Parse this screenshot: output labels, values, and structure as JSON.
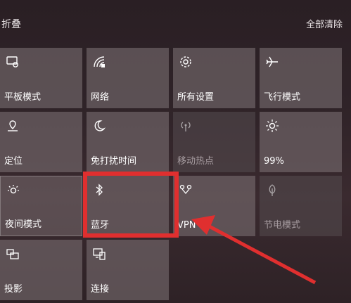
{
  "header": {
    "collapse_label": "折叠",
    "clear_all_label": "全部清除"
  },
  "tiles": [
    {
      "label": "平板模式",
      "icon": "tablet-mode-icon"
    },
    {
      "label": "网络",
      "icon": "network-icon"
    },
    {
      "label": "所有设置",
      "icon": "gear-icon"
    },
    {
      "label": "飞行模式",
      "icon": "airplane-icon"
    },
    {
      "label": "定位",
      "icon": "location-icon"
    },
    {
      "label": "免打扰时间",
      "icon": "moon-icon"
    },
    {
      "label": "移动热点",
      "icon": "hotspot-icon",
      "disabled": true
    },
    {
      "label": "99%",
      "icon": "brightness-icon"
    },
    {
      "label": "夜间模式",
      "icon": "night-light-icon"
    },
    {
      "label": "蓝牙",
      "icon": "bluetooth-icon"
    },
    {
      "label": "VPN",
      "icon": "vpn-icon"
    },
    {
      "label": "节电模式",
      "icon": "battery-saver-icon",
      "disabled": true
    },
    {
      "label": "投影",
      "icon": "project-icon"
    },
    {
      "label": "连接",
      "icon": "connect-icon"
    }
  ],
  "colors": {
    "highlight": "#e02f2f",
    "tile_bg": "#786c70"
  }
}
